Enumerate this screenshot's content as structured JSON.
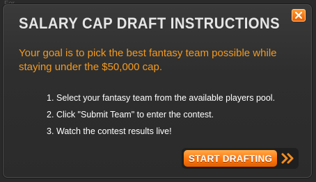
{
  "background": {
    "text": "For"
  },
  "modal": {
    "title": "SALARY CAP DRAFT INSTRUCTIONS",
    "close_icon": "close-x-icon",
    "goal_text": "Your goal is to pick the best fantasy team possible while staying under the $50,000 cap.",
    "steps": [
      {
        "num": "1.",
        "text": "Select your fantasy team from the available players pool."
      },
      {
        "num": "2.",
        "text": "Click \"Submit Team\" to enter the contest."
      },
      {
        "num": "3.",
        "text": "Watch the contest results live!"
      }
    ],
    "start_button_label": "START DRAFTING",
    "start_button_icon": "double-chevron-right-icon"
  },
  "colors": {
    "accent": "#f39a1f",
    "button_orange": "#ff7a10",
    "title": "#e6e6e6",
    "panel_bg": "#2e2e2e"
  }
}
